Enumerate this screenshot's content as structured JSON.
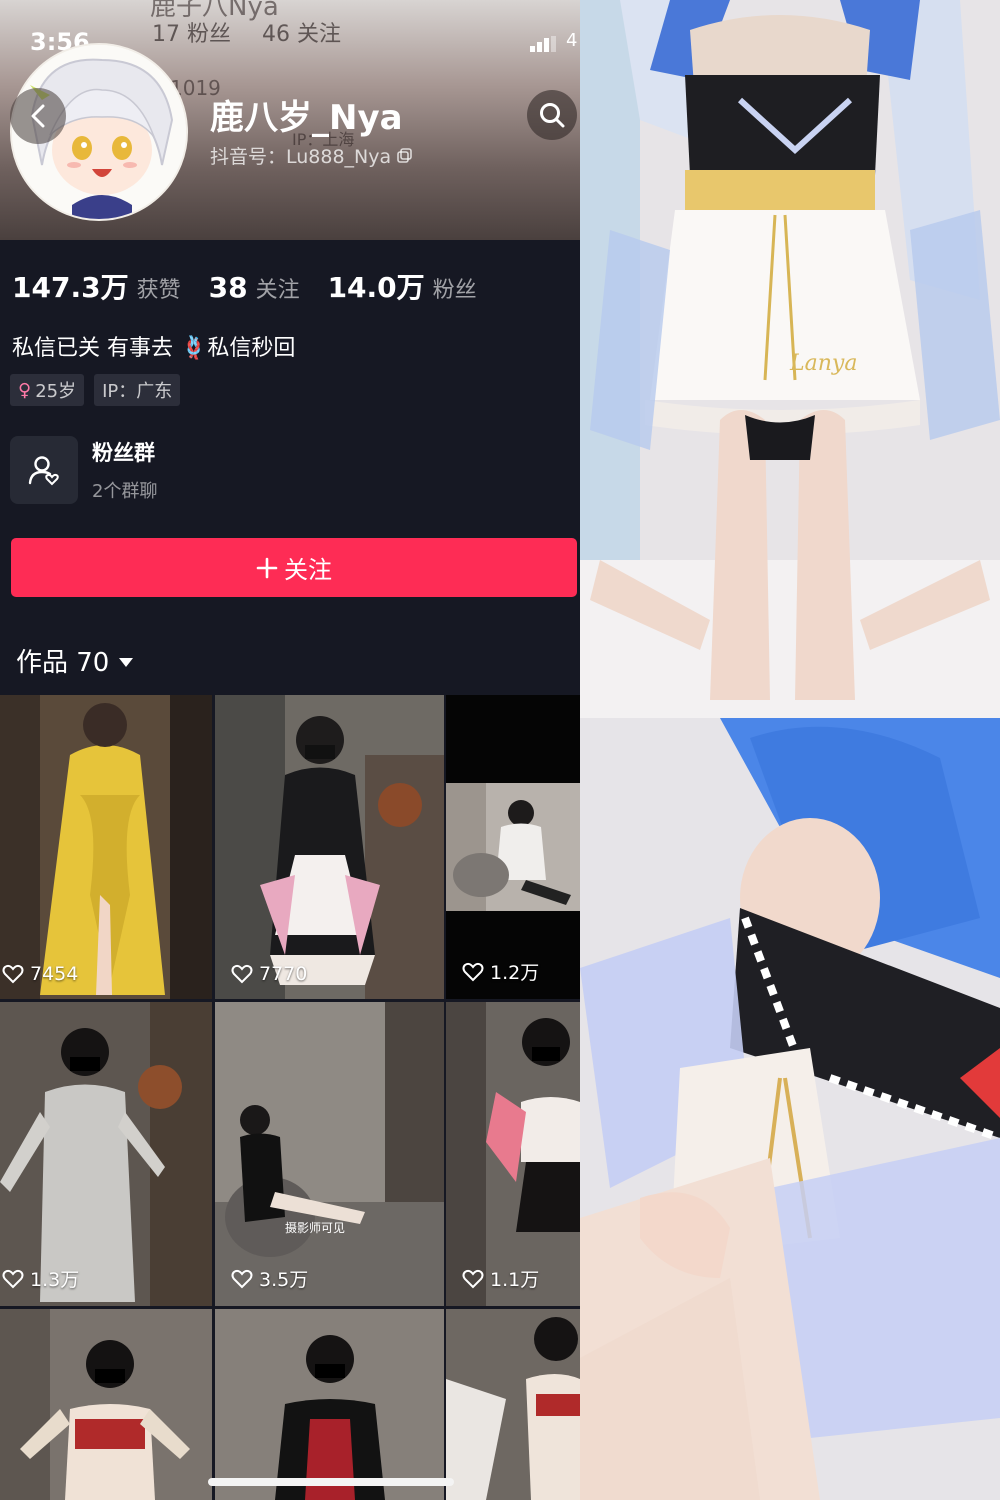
{
  "status_bar": {
    "time": "3:56",
    "battery": "4"
  },
  "header_faded": {
    "name": "鹿子八Nya",
    "fans": "17 粉丝",
    "following": "46 关注",
    "id_fragment": "1019",
    "tag_fragment": "IP：上海"
  },
  "profile": {
    "username": "鹿八岁_Nya",
    "douyin_id": "抖音号：Lu888_Nya"
  },
  "stats": [
    {
      "value": "147.3万",
      "label": "获赞"
    },
    {
      "value": "38",
      "label": "关注"
    },
    {
      "value": "14.0万",
      "label": "粉丝"
    }
  ],
  "bio": "私信已关 有事去 🪢私信秒回",
  "tags": {
    "age": "25岁",
    "ip": "IP：广东"
  },
  "fan_group": {
    "title": "粉丝群",
    "subtitle": "2个群聊"
  },
  "follow_button": {
    "label": "关注"
  },
  "works_tab": {
    "label": "作品 70"
  },
  "videos": [
    {
      "likes": "7454"
    },
    {
      "likes": "7770"
    },
    {
      "likes": "1.2万"
    },
    {
      "likes": "1.3万"
    },
    {
      "likes": "3.5万"
    },
    {
      "likes": "1.1万"
    }
  ],
  "video_captions": {
    "tile5": "摄影师可见"
  },
  "photo_top": {
    "logo_text": "Lanya"
  },
  "colors": {
    "accent": "#fe2c55",
    "background": "#161823",
    "tag_bg": "#2c2e3a"
  },
  "icons": [
    "back-arrow-icon",
    "search-icon",
    "copy-icon",
    "female-icon",
    "fan-group-icon",
    "plus-icon",
    "caret-down-icon",
    "heart-icon",
    "signal-icon"
  ]
}
